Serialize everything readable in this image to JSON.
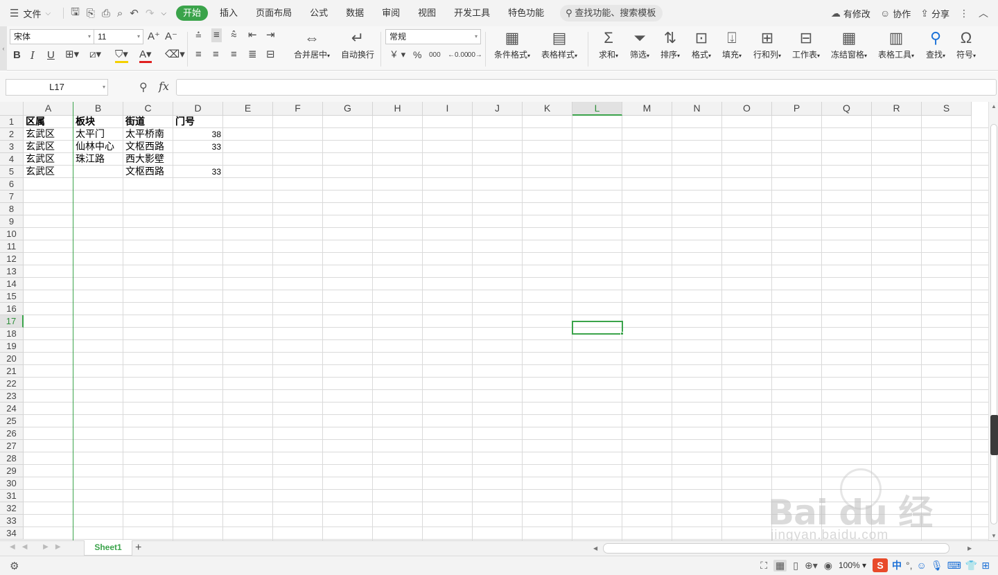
{
  "topbar": {
    "file_label": "文件",
    "tabs": [
      "开始",
      "插入",
      "页面布局",
      "公式",
      "数据",
      "审阅",
      "视图",
      "开发工具",
      "特色功能"
    ],
    "search_placeholder": "查找功能、搜索模板",
    "right": {
      "changes": "有修改",
      "collab": "协作",
      "share": "分享"
    }
  },
  "ribbon": {
    "font_name": "宋体",
    "font_size": "11",
    "merge_label": "合并居中",
    "wrap_label": "自动换行",
    "number_format": "常规",
    "currency_symbol": "￥",
    "percent_symbol": "%",
    "thousands_symbol": "000",
    "dec_inc": "←0.00",
    "dec_dec": ".00→",
    "cond_format": "条件格式",
    "table_style": "表格样式",
    "sum": "求和",
    "filter": "筛选",
    "sort": "排序",
    "format": "格式",
    "fill": "填充",
    "rowcol": "行和列",
    "worksheet": "工作表",
    "freeze": "冻结窗格",
    "table_tools": "表格工具",
    "find": "查找",
    "symbol": "符号"
  },
  "formula_bar": {
    "name_box": "L17",
    "fx": "fx",
    "formula": ""
  },
  "grid": {
    "columns": [
      "A",
      "B",
      "C",
      "D",
      "E",
      "F",
      "G",
      "H",
      "I",
      "J",
      "K",
      "L",
      "M",
      "N",
      "O",
      "P",
      "Q",
      "R",
      "S"
    ],
    "selected_column": "L",
    "rows": [
      "1",
      "2",
      "3",
      "4",
      "5",
      "6",
      "7",
      "8",
      "9",
      "10",
      "11",
      "12",
      "13",
      "14",
      "15",
      "16",
      "17",
      "18",
      "19",
      "20",
      "21",
      "22",
      "23",
      "24",
      "25",
      "26",
      "27",
      "28",
      "29",
      "30",
      "31",
      "32",
      "33",
      "34"
    ],
    "selected_row": "17",
    "header": [
      "区属",
      "板块",
      "街道",
      "门号"
    ],
    "data": [
      [
        "玄武区",
        "太平门",
        "太平桥南",
        "38"
      ],
      [
        "玄武区",
        "仙林中心",
        "文枢西路",
        "33"
      ],
      [
        "玄武区",
        "珠江路",
        "西大影壁",
        ""
      ],
      [
        "玄武区",
        "",
        "文枢西路",
        "33"
      ]
    ]
  },
  "sheets": {
    "active": "Sheet1",
    "add": "+"
  },
  "statusbar": {
    "zoom": "100%",
    "ime_lang": "中"
  },
  "watermark": {
    "brand": "Bai du 经验",
    "url": "jingyan.baidu.com"
  },
  "colors": {
    "accent": "#3aa34a",
    "font_color_underline": "#e02020",
    "fill_color_underline": "#f4d000"
  }
}
